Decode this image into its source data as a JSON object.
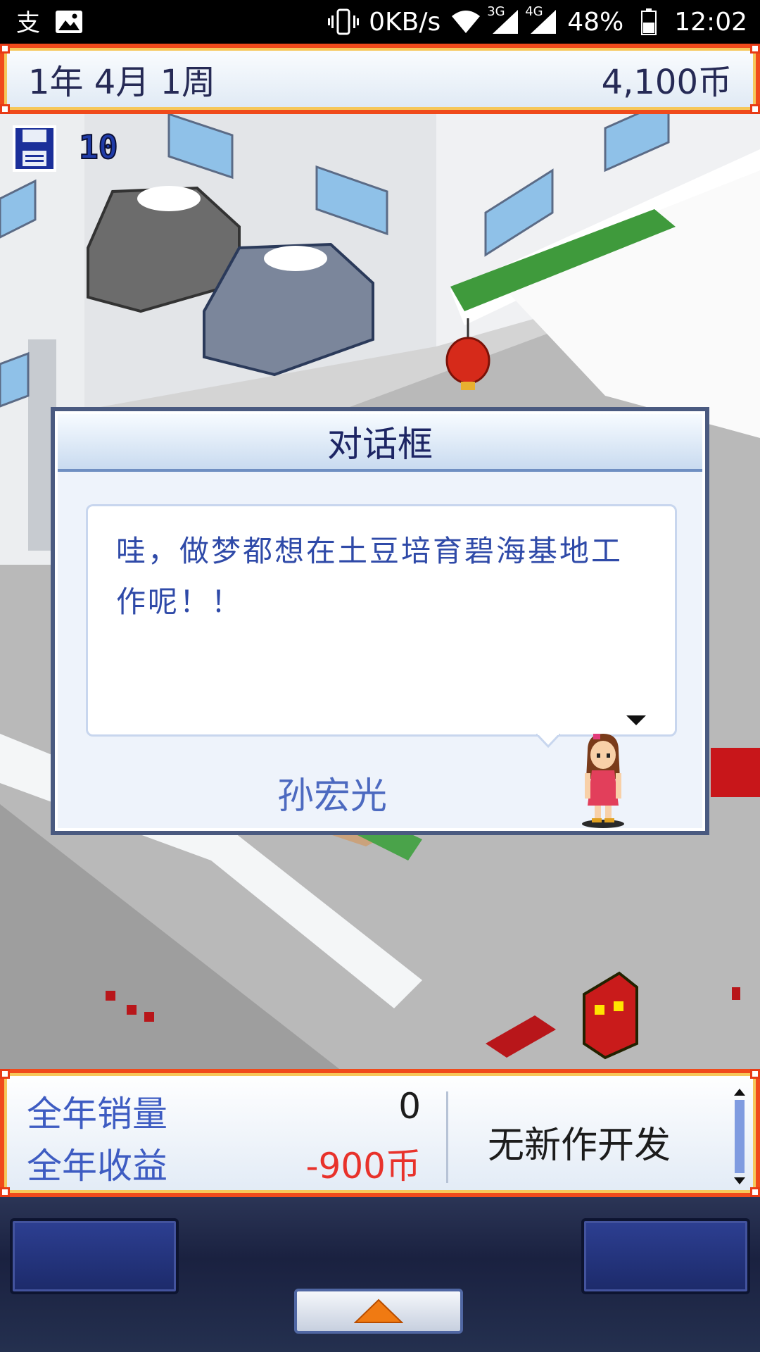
{
  "status_bar": {
    "left_icons": [
      "alipay-icon",
      "image-icon"
    ],
    "vibrate_icon": "vibrate-icon",
    "net_speed": "0KB/s",
    "wifi_icon": "wifi-icon",
    "sim1_label": "3G",
    "sim2_label": "4G",
    "battery": "48%",
    "time": "12:02"
  },
  "top_bar": {
    "date": "1年 4月 1周",
    "coins": "4,100币"
  },
  "save": {
    "icon": "floppy-disk-icon",
    "count": "10"
  },
  "dialog": {
    "title": "对话框",
    "message": "哇，做梦都想在土豆培育碧海基地工作呢！！",
    "speaker": "孙宏光"
  },
  "info_panel": {
    "annual_sales_label": "全年销量",
    "annual_sales_value": "0",
    "annual_profit_label": "全年收益",
    "annual_profit_value": "-900币",
    "dev_status": "无新作开发"
  },
  "colors": {
    "frame_red": "#f04a1b",
    "frame_gold": "#f6c75a",
    "profit_negative": "#e8322b",
    "label_blue": "#3e5cc2"
  }
}
